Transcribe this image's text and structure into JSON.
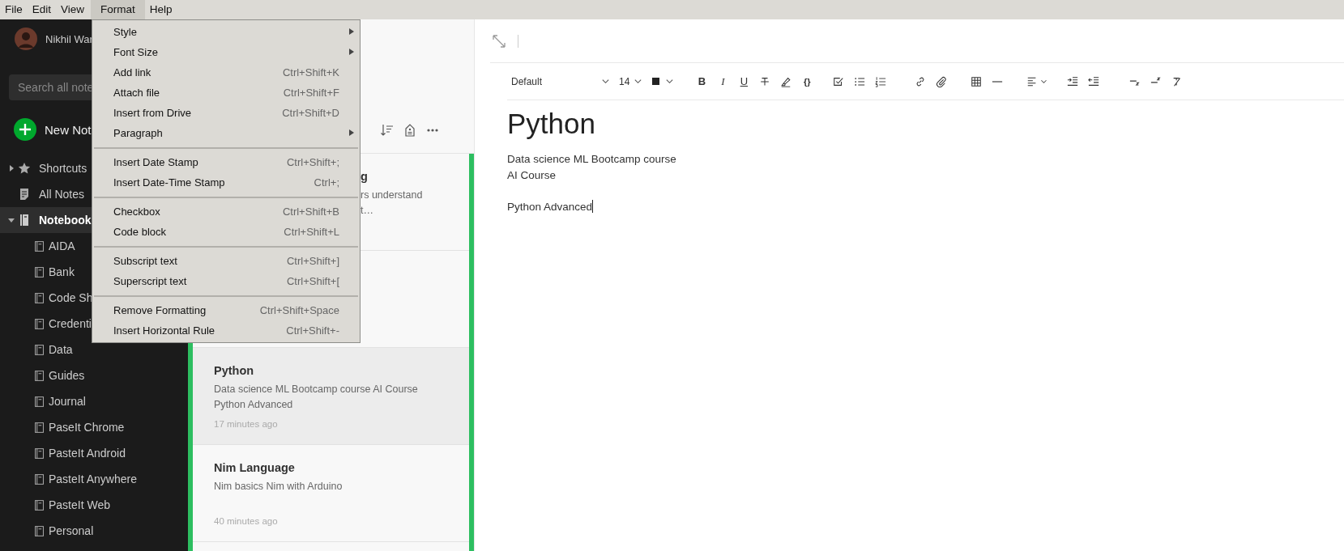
{
  "menubar": [
    {
      "label": "File",
      "selected": false
    },
    {
      "label": "Edit",
      "selected": false
    },
    {
      "label": "View",
      "selected": false
    },
    {
      "label": "Format",
      "selected": true
    },
    {
      "label": "Help",
      "selected": false
    }
  ],
  "format_menu": {
    "groups": [
      [
        {
          "kind": "submenu",
          "label": "Style"
        },
        {
          "kind": "submenu",
          "label": "Font Size"
        },
        {
          "kind": "command",
          "label": "Add link",
          "shortcut": "Ctrl+Shift+K"
        },
        {
          "kind": "command",
          "label": "Attach file",
          "shortcut": "Ctrl+Shift+F"
        },
        {
          "kind": "command",
          "label": "Insert from Drive",
          "shortcut": "Ctrl+Shift+D"
        },
        {
          "kind": "submenu",
          "label": "Paragraph"
        }
      ],
      [
        {
          "kind": "command",
          "label": "Insert Date Stamp",
          "shortcut": "Ctrl+Shift+;"
        },
        {
          "kind": "command",
          "label": "Insert Date-Time Stamp",
          "shortcut": "Ctrl+;"
        }
      ],
      [
        {
          "kind": "command",
          "label": "Checkbox",
          "shortcut": "Ctrl+Shift+B"
        },
        {
          "kind": "command",
          "label": "Code block",
          "shortcut": "Ctrl+Shift+L"
        }
      ],
      [
        {
          "kind": "command",
          "label": "Subscript text",
          "shortcut": "Ctrl+Shift+]"
        },
        {
          "kind": "command",
          "label": "Superscript text",
          "shortcut": "Ctrl+Shift+["
        }
      ],
      [
        {
          "kind": "command",
          "label": "Remove Formatting",
          "shortcut": "Ctrl+Shift+Space"
        },
        {
          "kind": "command",
          "label": "Insert Horizontal Rule",
          "shortcut": "Ctrl+Shift+-"
        }
      ]
    ]
  },
  "sidebar": {
    "user_name": "Nikhil War",
    "search": {
      "placeholder": "Search all note"
    },
    "new_note": "New Not",
    "tree": [
      {
        "kind": "shortcuts",
        "label": "Shortcuts",
        "expanded": false,
        "selected": false
      },
      {
        "kind": "all-notes",
        "label": "All Notes",
        "selected": false
      },
      {
        "kind": "notebooks",
        "label": "Notebook",
        "expanded": true,
        "selected": true,
        "children": [
          {
            "label": "AIDA"
          },
          {
            "label": "Bank"
          },
          {
            "label": "Code Sh"
          },
          {
            "label": "Credenti"
          },
          {
            "label": "Data"
          },
          {
            "label": "Guides"
          },
          {
            "label": "Journal"
          },
          {
            "label": "PaseIt Chrome"
          },
          {
            "label": "PasteIt Android"
          },
          {
            "label": "PasteIt Anywhere"
          },
          {
            "label": "PasteIt Web"
          },
          {
            "label": "Personal"
          }
        ]
      }
    ]
  },
  "note_list": {
    "notes": [
      {
        "kind": "partial",
        "title": "g",
        "snippet_lines": [
          "rs understand",
          "t…"
        ],
        "selected": false
      },
      {
        "kind": "covered",
        "selected": false
      },
      {
        "kind": "full",
        "title": "Python",
        "snippet": "Data science ML Bootcamp course AI Course Python Advanced",
        "time": "17 minutes ago",
        "selected": true
      },
      {
        "kind": "full",
        "title": "Nim Language",
        "snippet": "Nim basics Nim with Arduino",
        "time": "40 minutes ago",
        "selected": false
      }
    ]
  },
  "editor": {
    "toolbar": {
      "font": "Default",
      "size": "14",
      "marks": [
        "B",
        "I",
        "U",
        "{}"
      ]
    },
    "title": "Python",
    "paragraphs": [
      {
        "lines": [
          "Data science ML Bootcamp course",
          "AI Course"
        ]
      },
      {
        "lines": [
          "Python Advanced"
        ]
      }
    ]
  }
}
